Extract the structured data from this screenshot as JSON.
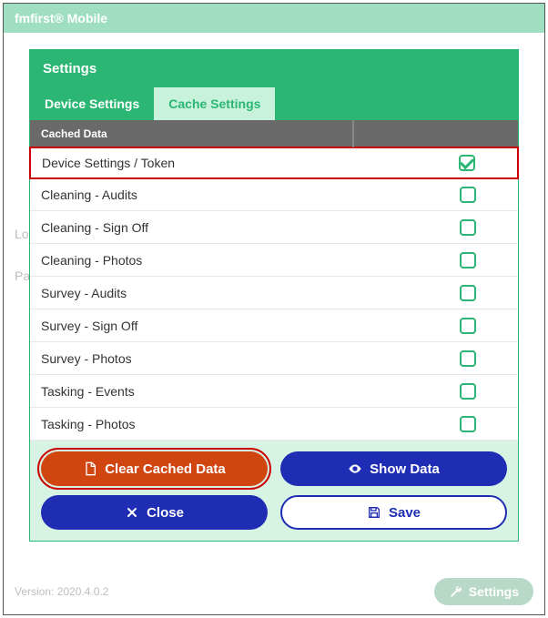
{
  "app_title": "fmfirst® Mobile",
  "background": {
    "login_label": "Log",
    "pass_label": "Pa"
  },
  "modal": {
    "title": "Settings",
    "tabs": [
      {
        "label": "Device Settings",
        "active": false
      },
      {
        "label": "Cache Settings",
        "active": true
      }
    ],
    "table_header": {
      "col1": "Cached Data",
      "col2": ""
    },
    "rows": [
      {
        "label": "Device Settings / Token",
        "checked": true,
        "highlight": true
      },
      {
        "label": "Cleaning - Audits",
        "checked": false,
        "highlight": false
      },
      {
        "label": "Cleaning - Sign Off",
        "checked": false,
        "highlight": false
      },
      {
        "label": "Cleaning - Photos",
        "checked": false,
        "highlight": false
      },
      {
        "label": "Survey - Audits",
        "checked": false,
        "highlight": false
      },
      {
        "label": "Survey - Sign Off",
        "checked": false,
        "highlight": false
      },
      {
        "label": "Survey - Photos",
        "checked": false,
        "highlight": false
      },
      {
        "label": "Tasking - Events",
        "checked": false,
        "highlight": false
      },
      {
        "label": "Tasking - Photos",
        "checked": false,
        "highlight": false
      }
    ],
    "buttons": {
      "clear": "Clear Cached Data",
      "show": "Show Data",
      "close": "Close",
      "save": "Save"
    }
  },
  "footer": {
    "version": "Version: 2020.4.0.2",
    "settings_label": "Settings"
  }
}
